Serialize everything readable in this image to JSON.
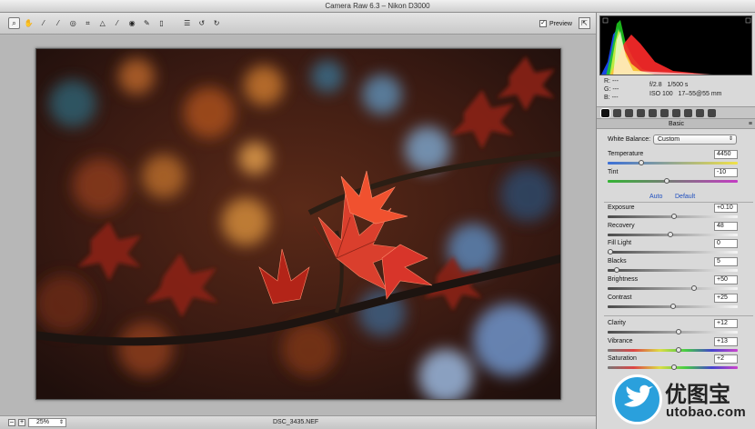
{
  "window": {
    "title": "Camera Raw 6.3  –  Nikon D3000"
  },
  "toolbar": {
    "tools": [
      {
        "name": "zoom-tool",
        "glyph": "⌕"
      },
      {
        "name": "hand-tool",
        "glyph": "✋"
      },
      {
        "name": "white-balance-tool",
        "glyph": "⁄"
      },
      {
        "name": "color-sampler-tool",
        "glyph": "⁄"
      },
      {
        "name": "targeted-adjustment-tool",
        "glyph": "◎"
      },
      {
        "name": "crop-tool",
        "glyph": "⌗"
      },
      {
        "name": "straighten-tool",
        "glyph": "△"
      },
      {
        "name": "spot-removal-tool",
        "glyph": "⁄"
      },
      {
        "name": "red-eye-tool",
        "glyph": "◉"
      },
      {
        "name": "adjustment-brush-tool",
        "glyph": "✎"
      },
      {
        "name": "graduated-filter-tool",
        "glyph": "▯"
      },
      {
        "name": "preferences-tool",
        "glyph": "☰"
      },
      {
        "name": "rotate-left-tool",
        "glyph": "↺"
      },
      {
        "name": "rotate-right-tool",
        "glyph": "↻"
      }
    ],
    "preview_label": "Preview",
    "preview_checked": true
  },
  "status": {
    "zoom": "25%",
    "filename": "DSC_3435.NEF"
  },
  "readout": {
    "r_label": "R:",
    "r_value": "---",
    "g_label": "G:",
    "g_value": "---",
    "b_label": "B:",
    "b_value": "---",
    "aperture": "f/2.8",
    "shutter": "1/500 s",
    "iso": "ISO 100",
    "lens": "17–55@55 mm"
  },
  "panel": {
    "title": "Basic",
    "white_balance_label": "White Balance:",
    "white_balance_value": "Custom",
    "auto_label": "Auto",
    "default_label": "Default"
  },
  "sliders": [
    {
      "label": "Temperature",
      "value": "4450",
      "fraction": 0.25,
      "track": "linear-gradient(90deg,#3a6fd8,#f0e14a)"
    },
    {
      "label": "Tint",
      "value": "-10",
      "fraction": 0.45,
      "track": "linear-gradient(90deg,#33b433,#c43cc4)"
    },
    {
      "label": "Exposure",
      "value": "+0.10",
      "fraction": 0.51,
      "track": "linear-gradient(90deg,#4a4a4a,#f5f5f5)"
    },
    {
      "label": "Recovery",
      "value": "48",
      "fraction": 0.48,
      "track": "linear-gradient(90deg,#4a4a4a,#f5f5f5)"
    },
    {
      "label": "Fill Light",
      "value": "0",
      "fraction": 0.0,
      "track": "linear-gradient(90deg,#4a4a4a,#f5f5f5)"
    },
    {
      "label": "Blacks",
      "value": "5",
      "fraction": 0.05,
      "track": "linear-gradient(90deg,#4a4a4a,#f5f5f5)"
    },
    {
      "label": "Brightness",
      "value": "+50",
      "fraction": 0.67,
      "track": "linear-gradient(90deg,#4a4a4a,#f5f5f5)"
    },
    {
      "label": "Contrast",
      "value": "+25",
      "fraction": 0.5,
      "track": "linear-gradient(90deg,#4a4a4a,#f5f5f5)"
    },
    {
      "label": "Clarity",
      "value": "+12",
      "fraction": 0.55,
      "track": "linear-gradient(90deg,#4a4a4a,#f5f5f5)"
    },
    {
      "label": "Vibrance",
      "value": "+13",
      "fraction": 0.55,
      "track": "linear-gradient(90deg,#777,#d44,#dd4,#4c4,#44c,#c4c)"
    },
    {
      "label": "Saturation",
      "value": "+2",
      "fraction": 0.51,
      "track": "linear-gradient(90deg,#777,#d44,#dd4,#4c4,#44c,#c4c)"
    }
  ],
  "watermark": {
    "text": "优图宝",
    "subtext": "utobao.com"
  }
}
